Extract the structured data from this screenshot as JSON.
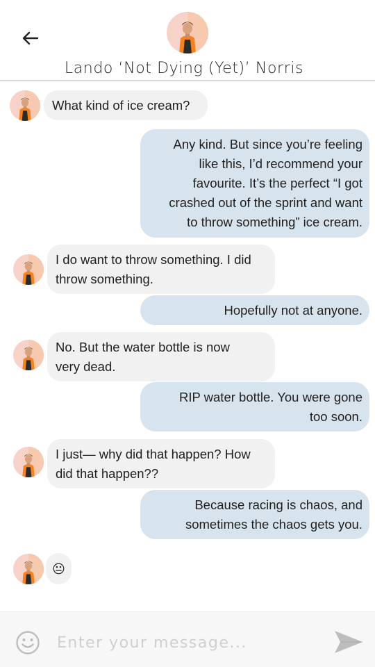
{
  "header": {
    "title": "Lando ‘Not Dying (Yet)’ Norris",
    "back_icon": "arrow-left-icon",
    "avatar_icon": "driver-avatar"
  },
  "messages": [
    {
      "from": "contact",
      "text": "What kind of ice cream?"
    },
    {
      "from": "me",
      "text": "Any kind. But since you’re feeling\nlike this, I’d recommend your\nfavourite. It’s the perfect “I got\ncrashed out of the sprint and want\nto throw something” ice cream."
    },
    {
      "from": "contact",
      "text": "I do want to throw something. I did\nthrow something."
    },
    {
      "from": "me",
      "text": "Hopefully not at anyone."
    },
    {
      "from": "contact",
      "text": "No. But the water bottle is now\nvery dead."
    },
    {
      "from": "me",
      "text": "RIP water bottle. You were gone\ntoo soon."
    },
    {
      "from": "contact",
      "text": "I just— why did that happen? How\ndid that happen??"
    },
    {
      "from": "me",
      "text": "Because racing is chaos, and\nsometimes the chaos gets you."
    },
    {
      "from": "contact",
      "text": "😐"
    }
  ],
  "composer": {
    "placeholder": "Enter your message...",
    "value": "",
    "emoji_icon": "smiley-icon",
    "send_icon": "send-arrow-icon"
  },
  "colors": {
    "incoming_bubble": "#f1f1f1",
    "outgoing_bubble": "#d7e4ed",
    "avatar_orange": "#f58220",
    "header_divider": "#d9d9d9"
  }
}
